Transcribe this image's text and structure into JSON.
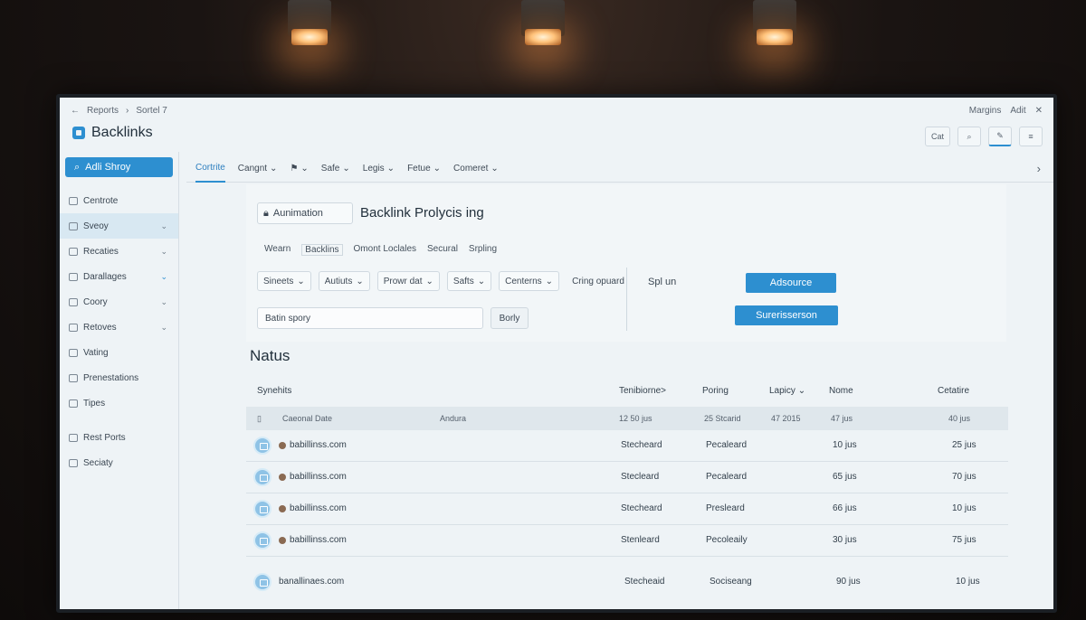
{
  "window": {
    "crumbs": [
      "Reports",
      "Sortel 7"
    ],
    "right_items": [
      "Margins",
      "Adit"
    ],
    "close": "✕"
  },
  "app": {
    "title": "Backlinks"
  },
  "toolbar": {
    "cat_label": "Cat",
    "search_icon": "search-icon",
    "edit_icon": "edit-icon",
    "menu_icon": "menu-icon"
  },
  "sidebar": {
    "primary_button": "Adli Shroy",
    "items": [
      {
        "label": "Centrote",
        "chevron": ""
      },
      {
        "label": "Sveoy",
        "chevron": "⌄"
      },
      {
        "label": "Recaties",
        "chevron": "⌄"
      },
      {
        "label": "Darallages",
        "chevron": "⌄"
      },
      {
        "label": "Coory",
        "chevron": "⌄"
      },
      {
        "label": "Retoves",
        "chevron": "⌄"
      },
      {
        "label": "Vating",
        "chevron": ""
      },
      {
        "label": "Prenestations",
        "chevron": ""
      },
      {
        "label": "Tipes",
        "chevron": ""
      },
      {
        "label": "Rest Ports",
        "chevron": ""
      },
      {
        "label": "Seciaty",
        "chevron": ""
      }
    ]
  },
  "nav": {
    "tabs": [
      "Cortrite",
      "Cangnt",
      "",
      "Safe",
      "Legis",
      "Fetue",
      "Comeret"
    ],
    "next": "›"
  },
  "panel": {
    "lock_label": "Aunimation",
    "title": "Backlink Prolycis ing",
    "subtabs": [
      "Wearn",
      "Backlins",
      "Omont Loclales",
      "Secural",
      "Srpling"
    ],
    "filters": [
      "Sineets",
      "Autiuts",
      "Prowr dat",
      "Safts",
      "Centerns",
      "Cring opuard"
    ],
    "search_value": "Batin spory",
    "apply_label": "Borly",
    "right_label": "Spl un",
    "button1": "Adsource",
    "button2": "Surerisserson"
  },
  "table": {
    "section_title": "Natus",
    "headers": [
      "Synehits",
      "Tenibiorne>",
      "Poring",
      "Lapicy",
      "Nome",
      "Cetatire"
    ],
    "subhead": [
      "Caeonal Date",
      "Andura",
      "12 50 jus",
      "25 Stcarid",
      "47 2015",
      "47 jus",
      "40 jus"
    ],
    "rows": [
      {
        "domain": "babillinss.com",
        "c1": "Stecheard",
        "c2": "Pecaleard",
        "c3": "10 jus",
        "c4": "25 jus"
      },
      {
        "domain": "babillinss.com",
        "c1": "Stecleard",
        "c2": "Pecaleard",
        "c3": "65 jus",
        "c4": "70 jus"
      },
      {
        "domain": "babillinss.com",
        "c1": "Stecheard",
        "c2": "Presleard",
        "c3": "66 jus",
        "c4": "10 jus"
      },
      {
        "domain": "babillinss.com",
        "c1": "Stenleard",
        "c2": "Pecoleaily",
        "c3": "30 jus",
        "c4": "75 jus"
      },
      {
        "domain": "banallinaes.com",
        "c1": "Stecheaid",
        "c2": "Sociseang",
        "c3": "90 jus",
        "c4": "10 jus"
      }
    ]
  }
}
